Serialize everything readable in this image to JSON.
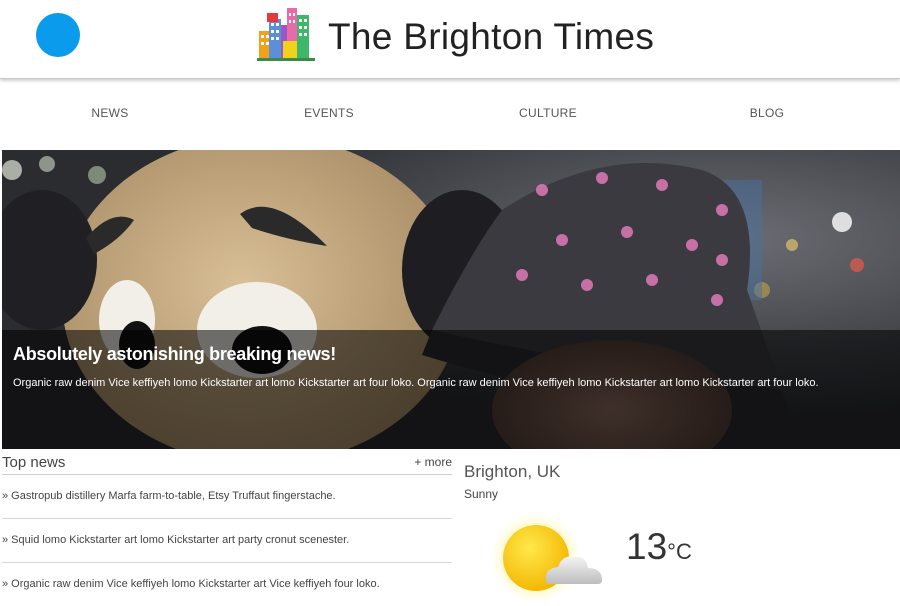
{
  "header": {
    "menu_icon": "menu-dot-icon",
    "logo_icon": "city-buildings-logo-icon",
    "title": "The Brighton Times",
    "accent_color": "#0a9bec"
  },
  "nav": {
    "items": [
      {
        "label": "NEWS"
      },
      {
        "label": "EVENTS"
      },
      {
        "label": "CULTURE"
      },
      {
        "label": "BLOG"
      }
    ]
  },
  "hero": {
    "headline": "Absolutely astonishing breaking news!",
    "summary": "Organic raw denim Vice keffiyeh lomo Kickstarter art lomo Kickstarter art four loko. Organic raw denim Vice keffiyeh lomo Kickstarter art lomo Kickstarter art four loko."
  },
  "top_news": {
    "title": "Top news",
    "more_label": "+ more",
    "items": [
      {
        "text": "» Gastropub distillery Marfa farm-to-table, Etsy Truffaut fingerstache."
      },
      {
        "text": "» Squid lomo Kickstarter art lomo Kickstarter art party cronut scenester."
      },
      {
        "text": "» Organic raw denim Vice keffiyeh lomo Kickstarter art Vice keffiyeh four loko."
      }
    ]
  },
  "weather": {
    "city": "Brighton, UK",
    "condition": "Sunny",
    "icon": "sun-cloud-icon",
    "temperature": "13",
    "unit": "°C"
  }
}
